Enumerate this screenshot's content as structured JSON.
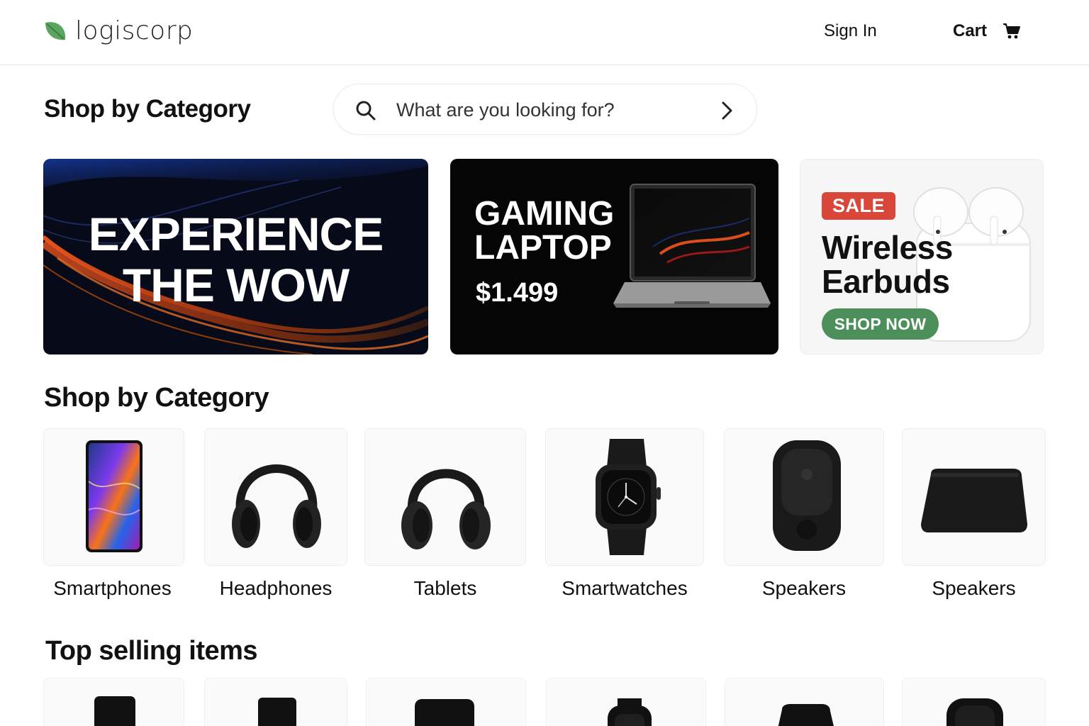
{
  "header": {
    "logo_text": "logiscorp",
    "sign_in": "Sign In",
    "cart": "Cart"
  },
  "search": {
    "placeholder": "What are you looking for?"
  },
  "sections": {
    "category_title_top": "Shop by Category",
    "category_title": "Shop by Category",
    "top_selling_title": "Top selling items"
  },
  "banners": [
    {
      "title_line1": "EXPERIENCE",
      "title_line2": "THE WOW"
    },
    {
      "title_line1": "GAMING",
      "title_line2": "LAPTOP",
      "price": "$1.499"
    },
    {
      "badge": "SALE",
      "title_line1": "Wireless",
      "title_line2": "Earbuds",
      "cta": "SHOP NOW"
    }
  ],
  "categories": [
    {
      "label": "Smartphones",
      "icon": "smartphone-icon"
    },
    {
      "label": "Headphones",
      "icon": "headphones-icon"
    },
    {
      "label": "Tablets",
      "icon": "headphones-icon"
    },
    {
      "label": "Smartwatches",
      "icon": "smartwatch-icon"
    },
    {
      "label": "Speakers",
      "icon": "speaker-icon"
    },
    {
      "label": "Speakers",
      "icon": "speaker-icon"
    }
  ],
  "colors": {
    "brand_green": "#4c8f5b",
    "sale_red": "#d9473b",
    "text": "#111111"
  }
}
